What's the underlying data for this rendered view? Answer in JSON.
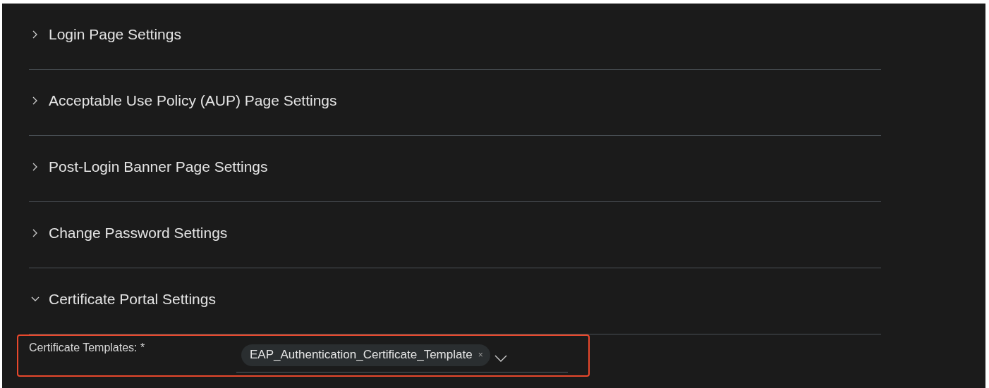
{
  "sections": [
    {
      "title": "Login Page Settings",
      "expanded": false
    },
    {
      "title": "Acceptable Use Policy (AUP) Page Settings",
      "expanded": false
    },
    {
      "title": "Post-Login Banner Page Settings",
      "expanded": false
    },
    {
      "title": "Change Password Settings",
      "expanded": false
    },
    {
      "title": "Certificate Portal Settings",
      "expanded": true,
      "fields": [
        {
          "label": "Certificate Templates: *",
          "highlighted": true,
          "chips": [
            {
              "text": "EAP_Authentication_Certificate_Template",
              "remove": "×"
            }
          ]
        }
      ]
    }
  ]
}
